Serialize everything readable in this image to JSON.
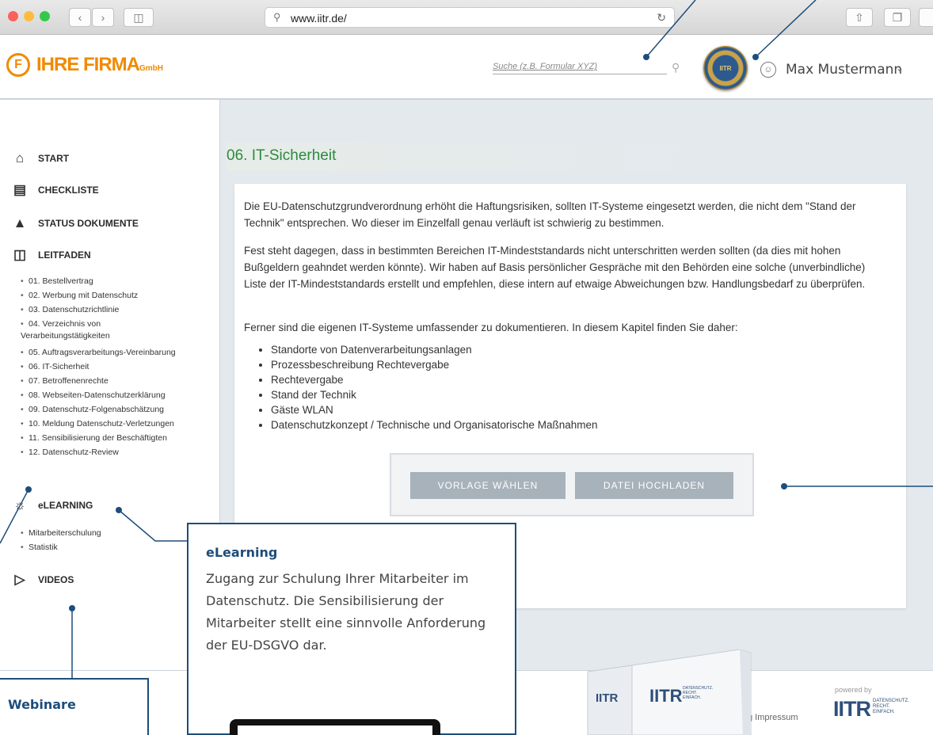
{
  "browser": {
    "url": "www.iitr.de/"
  },
  "header": {
    "logo_letter": "F",
    "logo_text": "IHRE FIRMA",
    "logo_suffix": "GmbH",
    "search_placeholder": "Suche (z.B. Formular XYZ)",
    "seal_text": "IITR",
    "user_name": "Max Mustermann"
  },
  "sidebar": {
    "start": "START",
    "checkliste": "CHECKLISTE",
    "status": "STATUS DOKUMENTE",
    "leitfaden": "LEITFADEN",
    "leitfaden_items": [
      "01. Bestellvertrag",
      "02. Werbung mit Datenschutz",
      "03. Datenschutzrichtlinie",
      "04. Verzeichnis von",
      "05. Auftragsverarbeitungs-Vereinbarung",
      "06. IT-Sicherheit",
      "07. Betroffenenrechte",
      "08. Webseiten-Datenschutzerklärung",
      "09. Datenschutz-Folgenabschätzung",
      "10. Meldung Datenschutz-Verletzungen",
      "11. Sensibilisierung der Beschäftigten",
      "12. Datenschutz-Review"
    ],
    "leitfaden_item4_cont": "Verarbeitungstätigkeiten",
    "elearning": "eLEARNING",
    "elearning_items": [
      "Mitarbeiterschulung",
      "Statistik"
    ],
    "videos": "VIDEOS"
  },
  "main": {
    "title": "06. IT-Sicherheit",
    "p1": "Die EU-Datenschutzgrundverordnung erhöht die Haftungsrisiken, sollten IT-Systeme eingesetzt werden, die nicht dem \"Stand der Technik\" entsprechen. Wo dieser im Einzelfall genau verläuft ist schwierig zu bestimmen.",
    "p2": "Fest steht dagegen, dass in bestimmten Bereichen IT-Mindeststandards nicht unterschritten werden sollten (da dies mit hohen Bußgeldern geahndet werden könnte). Wir haben auf Basis persönlicher Gespräche mit den Behörden eine solche (unverbindliche) Liste der IT-Mindeststandards erstellt und empfehlen, diese intern auf etwaige Abweichungen bzw. Handlungsbedarf zu überprüfen.",
    "p3": "Ferner sind die eigenen IT-Systeme umfassender zu dokumentieren. In diesem Kapitel finden Sie daher:",
    "list": [
      "Standorte von Datenverarbeitungsanlagen",
      "Prozessbeschreibung Rechtevergabe",
      "Rechtevergabe",
      "Stand der Technik",
      "Gäste WLAN",
      "Datenschutzkonzept / Technische und Organisatorische Maßnahmen"
    ],
    "btn_template": "VORLAGE WÄHLEN",
    "btn_upload": "DATEI HOCHLADEN"
  },
  "footer": {
    "impressum": "g  Impressum",
    "powered_by": "powered by",
    "brand": "IITR",
    "tagline_1": "DATENSCHUTZ.",
    "tagline_2": "RECHT.",
    "tagline_3": "EINFACH."
  },
  "binder": {
    "spine_label": "IITR",
    "cover_label": "IITR",
    "cover_tag_1": "DATENSCHUTZ.",
    "cover_tag_2": "RECHT.",
    "cover_tag_3": "EINFACH."
  },
  "callouts": {
    "elearning_title": "eLearning",
    "elearning_body": "Zugang zur Schulung Ihrer Mitarbeiter im Datenschutz. Die Sensibilisierung der Mitarbeiter stellt eine sinnvolle Anforderung der EU-DSGVO dar.",
    "webinare_title": "Webinare"
  },
  "colors": {
    "brand_orange": "#f08a00",
    "title_green": "#2d8a3e",
    "callout_blue": "#1d4d7a",
    "button_grey": "#a7b2bb"
  }
}
